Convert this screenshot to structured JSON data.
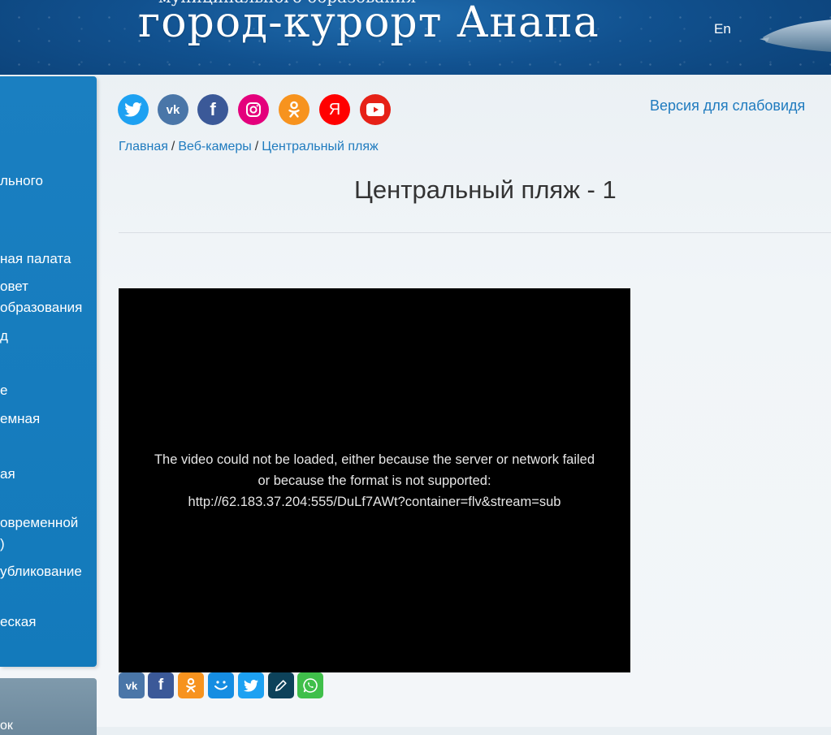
{
  "header": {
    "subtitle": "муниципального образования",
    "title": "город-курорт Анапа",
    "lang_link": "En"
  },
  "sidebar": {
    "items": [
      {
        "label": "льного"
      },
      {
        "label": "ная палата"
      },
      {
        "label": "овет"
      },
      {
        "label": "образования"
      },
      {
        "label": "д"
      },
      {
        "label": "е"
      },
      {
        "label": "емная"
      },
      {
        "label": "ая"
      },
      {
        "label": "овременной"
      },
      {
        "label": ")"
      },
      {
        "label": "убликование"
      },
      {
        "label": "еская"
      }
    ],
    "bottom_label": "ок"
  },
  "social": {
    "icons": [
      {
        "name": "twitter",
        "glyph": "🐦",
        "color": "#1da1f2"
      },
      {
        "name": "vk",
        "glyph": "vk",
        "color": "#4a76a8"
      },
      {
        "name": "facebook",
        "glyph": "f",
        "color": "#3b5998"
      },
      {
        "name": "instagram",
        "glyph": "◎",
        "color": "#e4007c"
      },
      {
        "name": "odnoklassniki",
        "glyph": "ок",
        "color": "#f7931e"
      },
      {
        "name": "yandex",
        "glyph": "Я",
        "color": "#ff0000"
      },
      {
        "name": "youtube",
        "glyph": "▶",
        "color": "#e62117"
      }
    ],
    "low_vision_link": "Версия для слабовидя"
  },
  "breadcrumb": {
    "home": "Главная",
    "section": "Веб-камеры",
    "current": "Центральный пляж",
    "separator": "/"
  },
  "page_title": "Центральный пляж - 1",
  "video": {
    "error_line1": "The video could not be loaded, either because the server or network failed",
    "error_line2": "or because the format is not supported:",
    "error_line3": "http://62.183.37.204:555/DuLf7AWt?container=flv&stream=sub"
  },
  "share": {
    "buttons": [
      {
        "name": "vk",
        "glyph": "vk",
        "color": "#4a76a8"
      },
      {
        "name": "facebook",
        "glyph": "f",
        "color": "#3b5998"
      },
      {
        "name": "odnoklassniki",
        "glyph": "ок",
        "color": "#f7931e"
      },
      {
        "name": "moimir",
        "glyph": "☺",
        "color": "#168de2"
      },
      {
        "name": "twitter",
        "glyph": "🐦",
        "color": "#1da1f2"
      },
      {
        "name": "livejournal",
        "glyph": "✎",
        "color": "#0d425a"
      },
      {
        "name": "whatsapp",
        "glyph": "✆",
        "color": "#3fbf4a"
      }
    ]
  }
}
